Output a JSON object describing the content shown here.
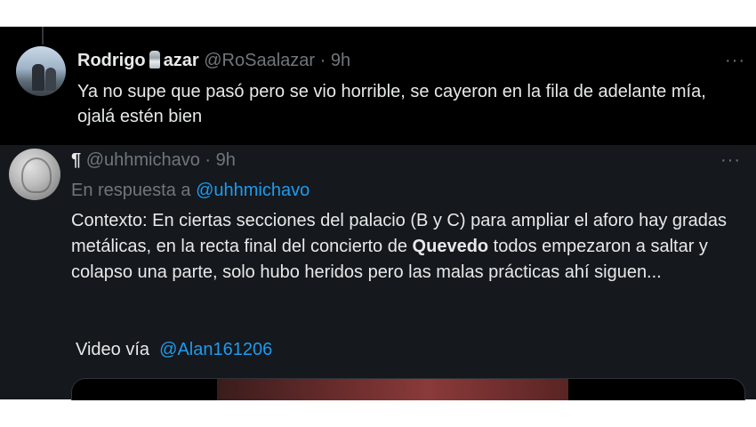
{
  "tweet1": {
    "display_name_part1": "Rodrigo",
    "display_name_part2": "azar",
    "handle": "@RoSaalazar",
    "separator": "·",
    "time": "9h",
    "more": "···",
    "text": "Ya no supe que pasó pero se vio horrible, se cayeron en la fila de adelante mía, ojalá estén bien"
  },
  "tweet2": {
    "pilcrow": "¶",
    "handle": "@uhhmichavo",
    "separator": "·",
    "time": "9h",
    "more": "···",
    "reply_prefix": "En respuesta a",
    "reply_handle": "@uhhmichavo",
    "text_before": "Contexto: En ciertas secciones del palacio (B y C) para ampliar el aforo hay gradas metálicas, en la recta final del concierto de ",
    "text_bold": "Quevedo",
    "text_after": " todos empezaron a saltar y colapso una parte, solo hubo heridos pero las malas prácticas ahí siguen...",
    "video_label": "Video vía",
    "video_handle": "@Alan161206"
  },
  "colors": {
    "background_dark": "#000000",
    "background_reply": "#15181c",
    "text_primary": "#e7e9ea",
    "text_secondary": "#71767b",
    "link": "#1d9bf0"
  },
  "icons": {
    "tweet1_emoji": "salt-shaker-icon",
    "more": "more-options-icon"
  }
}
